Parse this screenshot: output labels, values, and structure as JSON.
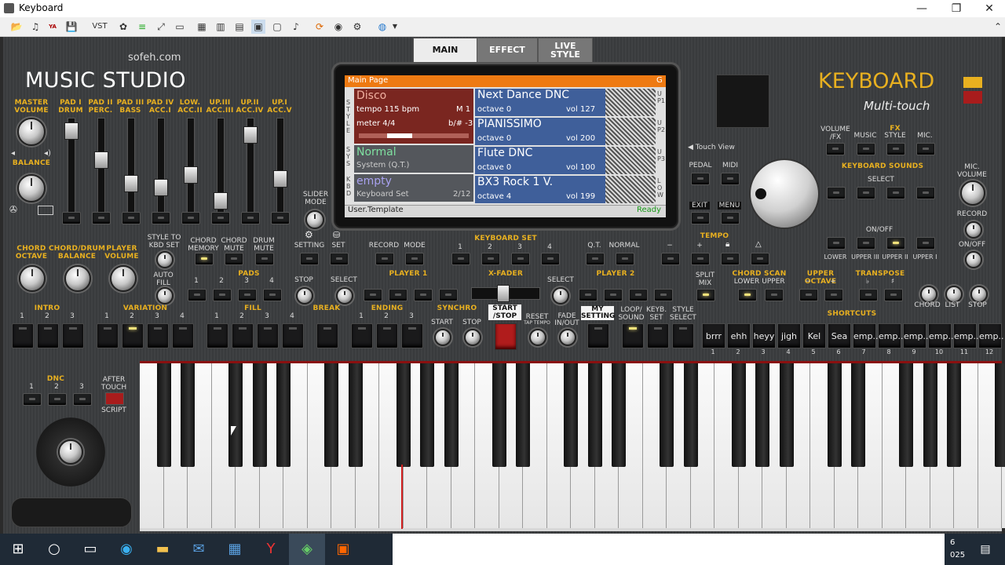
{
  "window": {
    "title": "Keyboard",
    "minimize": "—",
    "maximize": "❐",
    "close": "✕"
  },
  "toolbar": {
    "vst": "VST"
  },
  "brand": {
    "site": "sofeh.com",
    "app_name": "MUSIC STUDIO",
    "product": "KEYBOARD",
    "product_sub": "Multi-touch"
  },
  "tabs": [
    "MAIN",
    "EFFECT",
    "LIVE\nSTYLE"
  ],
  "left": {
    "master_volume": "MASTER\nVOLUME",
    "balance": "BALANCE",
    "slider_mode": "SLIDER\nMODE",
    "channels": [
      "PAD I\nDRUM",
      "PAD II\nPERC.",
      "PAD III\nBASS",
      "PAD IV\nACC.I",
      "LOW.\nACC.II",
      "UP.III\nACC.III",
      "UP.II\nACC.IV",
      "UP.I\nACC.V"
    ],
    "slider_levels": [
      0.95,
      0.62,
      0.35,
      0.3,
      0.45,
      0.15,
      0.9,
      0.4
    ]
  },
  "screen": {
    "header": "Main Page",
    "header_flag": "G",
    "side_style": "STYLE",
    "side_sys": "SYS",
    "side_kbd": "KBD",
    "style": {
      "name": "Disco",
      "tempo": "tempo 115 bpm",
      "measure": "M 1",
      "meter": "meter 4/4",
      "key": "b/# -3"
    },
    "system": {
      "name": "Normal",
      "sub": "System (Q.T.)"
    },
    "kbdset": {
      "name": "empty",
      "sub": "Keyboard Set",
      "count": "2/12"
    },
    "voices": [
      {
        "tag": "UP1",
        "name": "Next Dance DNC",
        "octave": "octave 0",
        "vol": "vol 127"
      },
      {
        "tag": "UP2",
        "name": "PIANISSIMO",
        "octave": "octave 0",
        "vol": "vol 200"
      },
      {
        "tag": "UP3",
        "name": "Flute DNC",
        "octave": "octave 0",
        "vol": "vol 100"
      },
      {
        "tag": "LOW",
        "name": "BX3 Rock 1 V.",
        "octave": "octave 4",
        "vol": "vol 199"
      }
    ],
    "footer_left": "User.Template",
    "footer_right": "Ready"
  },
  "right": {
    "touch_view": "◀ Touch View",
    "volume_fx": "VOLUME\n/FX",
    "fx": "FX",
    "fx_items": [
      "MUSIC",
      "STYLE",
      "MIC."
    ],
    "pedal": "PEDAL",
    "midi": "MIDI",
    "exit": "EXIT",
    "menu": "MENU",
    "keyboard_sounds": "KEYBOARD SOUNDS",
    "select": "SELECT",
    "on_off": "ON/OFF",
    "lower_labels": [
      "LOWER",
      "UPPER III",
      "UPPER II",
      "UPPER I"
    ],
    "mic_volume": "MIC.\nVOLUME",
    "record": "RECORD",
    "on_off2": "ON/OFF"
  },
  "row2": {
    "chord_octave": "CHORD\nOCTAVE",
    "chord_drum_balance": "CHORD/DRUM\nBALANCE",
    "player_volume": "PLAYER\nVOLUME",
    "style_to_kbd": "STYLE TO\nKBD SET",
    "chord_memory": "CHORD\nMEMORY",
    "chord_mute": "CHORD\nMUTE",
    "drum_mute": "DRUM\nMUTE",
    "setting": "SETTING",
    "set": "SET",
    "record": "RECORD",
    "mode": "MODE",
    "keyboard_set": "KEYBOARD SET",
    "kbd_nums": [
      "1",
      "2",
      "3",
      "4"
    ],
    "qt": "Q.T.",
    "normal": "NORMAL",
    "tempo": "TEMPO",
    "tempo_minus": "−",
    "tempo_plus": "+"
  },
  "row3": {
    "auto_fill": "AUTO\nFILL",
    "pads": "PADS",
    "pad_nums": [
      "1",
      "2",
      "3",
      "4"
    ],
    "stop": "STOP",
    "select": "SELECT",
    "player1": "PLAYER 1",
    "xfader": "X-FADER",
    "player2": "PLAYER 2",
    "split_mix": "SPLIT\nMIX",
    "chord_scan": "CHORD SCAN",
    "lower": "LOWER",
    "upper": "UPPER",
    "upper_octave": "UPPER OCTAVE",
    "oct_minus": "−",
    "oct_plus": "+",
    "transpose": "TRANSPOSE",
    "flat": "♭",
    "sharp": "♯",
    "chord": "CHORD",
    "list": "LIST",
    "stop2": "STOP"
  },
  "row4": {
    "intro": "INTRO",
    "variation": "VARIATION",
    "fill": "FILL",
    "break": "BREAK",
    "ending": "ENDING",
    "synchro": "SYNCHRO",
    "start": "START",
    "stop": "STOP",
    "start_stop": "START\n/STOP",
    "reset": "RESET",
    "tap_tempo": "TAP TEMPO",
    "fade": "FADE\nIN/OUT",
    "my_setting": "MY\nSETTING",
    "loop_sound": "LOOP/\nSOUND",
    "keyb_set": "KEYB.\nSET",
    "style_select": "STYLE\nSELECT",
    "shortcuts": "SHORTCUTS",
    "shortcut_items": [
      "brrr",
      "ehh",
      "heyy",
      "jigh",
      "Kel",
      "Sea",
      "emp..",
      "emp..",
      "emp..",
      "emp..",
      "emp..",
      "emp.."
    ],
    "shortcut_nums": [
      "1",
      "2",
      "3",
      "4",
      "5",
      "6",
      "7",
      "8",
      "9",
      "10",
      "11",
      "12"
    ]
  },
  "bottom": {
    "dnc": "DNC",
    "dnc_nums": [
      "1",
      "2",
      "3"
    ],
    "after_touch": "AFTER\nTOUCH",
    "script": "SCRIPT"
  },
  "taskbar": {
    "time": "6",
    "date": "025"
  },
  "colors": {
    "accent": "#e8b020",
    "screen_header": "#ee7a12",
    "style_cell": "#7a2620",
    "voice_cell": "#3f5f9a",
    "system_cell": "#54575c"
  }
}
